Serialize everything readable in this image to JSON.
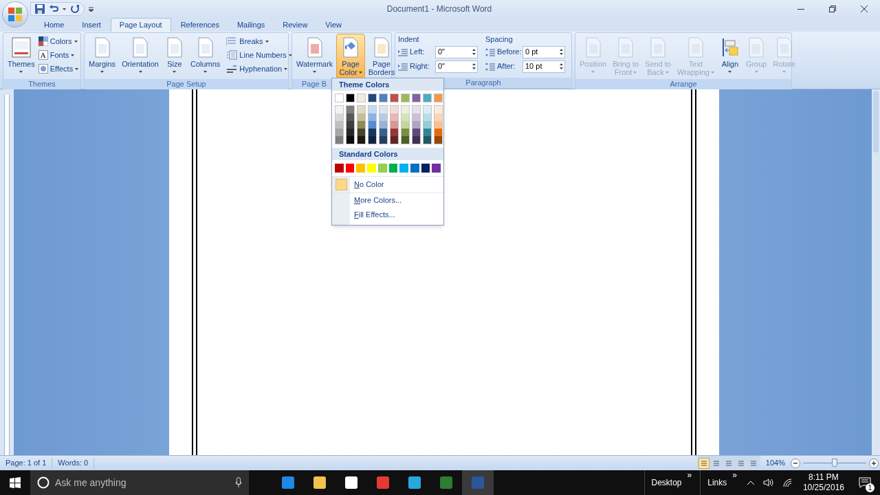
{
  "window": {
    "title": "Document1 - Microsoft Word"
  },
  "tabs": [
    {
      "label": "Home",
      "selected": false
    },
    {
      "label": "Insert",
      "selected": false
    },
    {
      "label": "Page Layout",
      "selected": true
    },
    {
      "label": "References",
      "selected": false
    },
    {
      "label": "Mailings",
      "selected": false
    },
    {
      "label": "Review",
      "selected": false
    },
    {
      "label": "View",
      "selected": false
    }
  ],
  "ribbon": {
    "themes": {
      "label": "Themes",
      "large": [
        {
          "lines": [
            "Themes"
          ],
          "has_menu": true
        }
      ],
      "small": [
        {
          "label": "Colors",
          "has_menu": true
        },
        {
          "label": "Fonts",
          "has_menu": true,
          "icon_text": "A"
        },
        {
          "label": "Effects",
          "has_menu": true
        }
      ]
    },
    "page_setup": {
      "label": "Page Setup",
      "large": [
        {
          "lines": [
            "Margins"
          ],
          "has_menu": true
        },
        {
          "lines": [
            "Orientation"
          ],
          "has_menu": true
        },
        {
          "lines": [
            "Size"
          ],
          "has_menu": true
        },
        {
          "lines": [
            "Columns"
          ],
          "has_menu": true
        }
      ],
      "small": [
        {
          "label": "Breaks",
          "has_menu": true
        },
        {
          "label": "Line Numbers",
          "has_menu": true
        },
        {
          "label": "Hyphenation",
          "has_menu": true
        }
      ]
    },
    "page_background": {
      "label": "Page B",
      "large": [
        {
          "lines": [
            "Watermark"
          ],
          "has_menu": true,
          "selected": false
        },
        {
          "lines": [
            "Page",
            "Color"
          ],
          "has_menu": true,
          "selected": true
        },
        {
          "lines": [
            "Page",
            "Borders"
          ],
          "has_menu": false,
          "selected": false
        }
      ]
    },
    "paragraph": {
      "label": "Paragraph",
      "indent": {
        "title": "Indent",
        "rows": [
          {
            "label": "Left:",
            "value": "0\""
          },
          {
            "label": "Right:",
            "value": "0\""
          }
        ]
      },
      "spacing": {
        "title": "Spacing",
        "rows": [
          {
            "label": "Before:",
            "value": "0 pt"
          },
          {
            "label": "After:",
            "value": "10 pt"
          }
        ]
      }
    },
    "arrange": {
      "label": "Arrange",
      "large": [
        {
          "lines": [
            "Position"
          ],
          "has_menu": true,
          "disabled": true
        },
        {
          "lines": [
            "Bring to",
            "Front"
          ],
          "has_menu": true,
          "disabled": true
        },
        {
          "lines": [
            "Send to",
            "Back"
          ],
          "has_menu": true,
          "disabled": true
        },
        {
          "lines": [
            "Text",
            "Wrapping"
          ],
          "has_menu": true,
          "disabled": true
        },
        {
          "lines": [
            "Align"
          ],
          "has_menu": true,
          "disabled": false
        },
        {
          "lines": [
            "Group"
          ],
          "has_menu": true,
          "disabled": true
        },
        {
          "lines": [
            "Rotate"
          ],
          "has_menu": true,
          "disabled": true
        }
      ]
    }
  },
  "page_color_menu": {
    "theme_title": "Theme Colors",
    "theme_colors": [
      {
        "color": "#ffffff",
        "shades": [
          {
            "color": "#f2f2f2"
          },
          {
            "color": "#d8d8d8"
          },
          {
            "color": "#bfbfbf"
          },
          {
            "color": "#a5a5a5"
          },
          {
            "color": "#7f7f7f"
          }
        ]
      },
      {
        "color": "#000000",
        "shades": [
          {
            "color": "#7f7f7f"
          },
          {
            "color": "#595959"
          },
          {
            "color": "#3f3f3f"
          },
          {
            "color": "#262626"
          },
          {
            "color": "#0c0c0c"
          }
        ]
      },
      {
        "color": "#eeece1",
        "shades": [
          {
            "color": "#ddd9c3"
          },
          {
            "color": "#c4bd97"
          },
          {
            "color": "#938953"
          },
          {
            "color": "#494429"
          },
          {
            "color": "#1d1b10"
          }
        ]
      },
      {
        "color": "#1f497d",
        "shades": [
          {
            "color": "#c6d9f0"
          },
          {
            "color": "#8db3e2"
          },
          {
            "color": "#548dd4"
          },
          {
            "color": "#17365d"
          },
          {
            "color": "#0f243e"
          }
        ]
      },
      {
        "color": "#4f81bd",
        "shades": [
          {
            "color": "#dbe5f1"
          },
          {
            "color": "#b8cce4"
          },
          {
            "color": "#95b3d7"
          },
          {
            "color": "#366092"
          },
          {
            "color": "#244061"
          }
        ]
      },
      {
        "color": "#c0504d",
        "shades": [
          {
            "color": "#f2dcdb"
          },
          {
            "color": "#e5b9b7"
          },
          {
            "color": "#d99694"
          },
          {
            "color": "#953734"
          },
          {
            "color": "#632423"
          }
        ]
      },
      {
        "color": "#9bbb59",
        "shades": [
          {
            "color": "#ebf1dd"
          },
          {
            "color": "#d7e3bc"
          },
          {
            "color": "#c3d69b"
          },
          {
            "color": "#76923c"
          },
          {
            "color": "#4f6128"
          }
        ]
      },
      {
        "color": "#8064a2",
        "shades": [
          {
            "color": "#e5e0ec"
          },
          {
            "color": "#ccc1d9"
          },
          {
            "color": "#b2a2c7"
          },
          {
            "color": "#5f497a"
          },
          {
            "color": "#3f3151"
          }
        ]
      },
      {
        "color": "#4bacc6",
        "shades": [
          {
            "color": "#dbeef3"
          },
          {
            "color": "#b7dde8"
          },
          {
            "color": "#92cddc"
          },
          {
            "color": "#31859b"
          },
          {
            "color": "#205867"
          }
        ]
      },
      {
        "color": "#f79646",
        "shades": [
          {
            "color": "#fdeada"
          },
          {
            "color": "#fbd5b5"
          },
          {
            "color": "#fac08f"
          },
          {
            "color": "#e36c09"
          },
          {
            "color": "#974806"
          }
        ]
      }
    ],
    "standard_title": "Standard Colors",
    "standard_colors": [
      {
        "color": "#c00000"
      },
      {
        "color": "#ff0000"
      },
      {
        "color": "#ffc000"
      },
      {
        "color": "#ffff00"
      },
      {
        "color": "#92d050"
      },
      {
        "color": "#00b050"
      },
      {
        "color": "#00b0f0"
      },
      {
        "color": "#0070c0"
      },
      {
        "color": "#002060"
      },
      {
        "color": "#7030a0"
      }
    ],
    "items": [
      {
        "kind": "swatch",
        "label": "No Color"
      },
      {
        "kind": "plain",
        "label": "More Colors..."
      },
      {
        "kind": "plain",
        "label": "Fill Effects..."
      }
    ]
  },
  "status_bar": {
    "page": "Page: 1 of 1",
    "words": "Words: 0",
    "views": [
      {
        "selected": true
      },
      {
        "selected": false
      },
      {
        "selected": false
      },
      {
        "selected": false
      },
      {
        "selected": false
      }
    ],
    "zoom": "104%",
    "zoom_slider": {
      "level": 0.5
    }
  },
  "taskbar": {
    "search_placeholder": "Ask me anything",
    "apps": [
      {
        "selected": false
      },
      {
        "selected": false
      },
      {
        "selected": false
      },
      {
        "selected": false
      },
      {
        "selected": false
      },
      {
        "selected": false
      },
      {
        "selected": true
      }
    ],
    "toolbars": [
      {
        "label": "Desktop",
        "chevron": "»"
      },
      {
        "label": "Links",
        "chevron": "»"
      }
    ],
    "time": "8:11 PM",
    "date": "10/25/2016",
    "notification_count": "1"
  }
}
